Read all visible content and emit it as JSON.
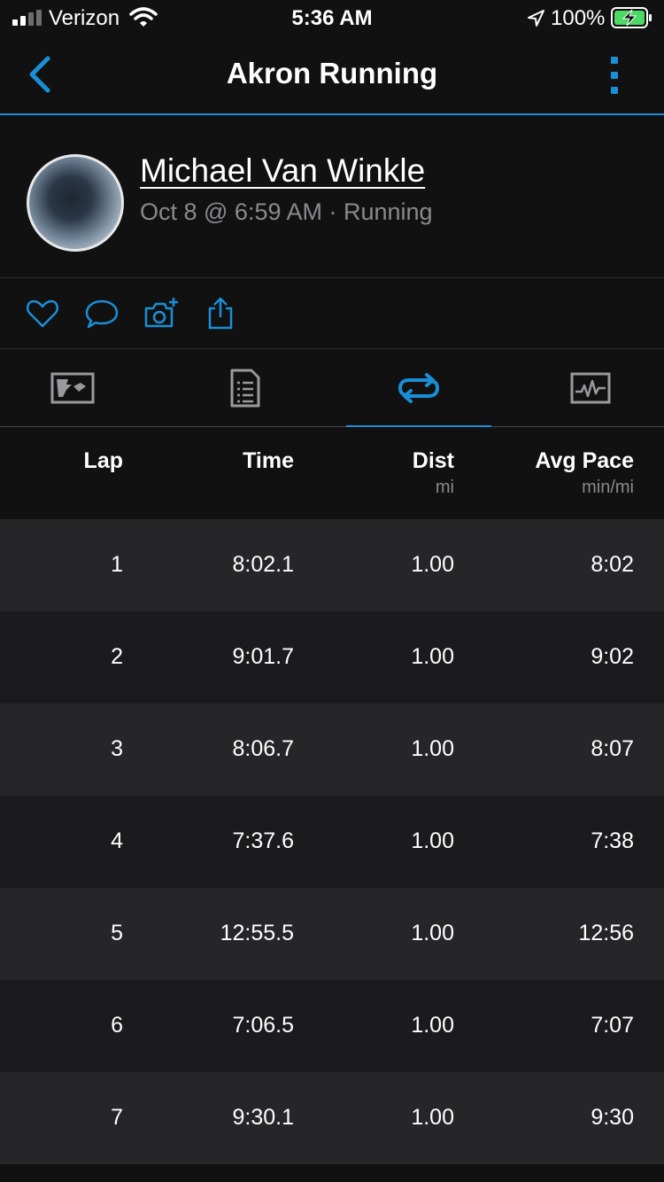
{
  "status_bar": {
    "carrier": "Verizon",
    "time": "5:36 AM",
    "battery": "100%"
  },
  "nav": {
    "title": "Akron Running",
    "back_icon": "chevron-left-icon",
    "more_icon": "more-vertical-icon"
  },
  "activity": {
    "user_name": "Michael Van Winkle",
    "subtitle": "Oct 8 @ 6:59 AM · Running"
  },
  "actions": [
    "like-icon",
    "comment-icon",
    "add-photo-icon",
    "share-icon"
  ],
  "tabs": [
    "map-tab",
    "details-tab",
    "laps-tab",
    "charts-tab"
  ],
  "active_tab": "laps-tab",
  "colors": {
    "accent": "#1a8fd6",
    "background": "#111112",
    "row_light": "#262628",
    "row_dark": "#1b1b1d",
    "muted_text": "#8a8a8e"
  },
  "table": {
    "headers": {
      "lap": "Lap",
      "time": "Time",
      "dist": "Dist",
      "dist_unit": "mi",
      "pace": "Avg Pace",
      "pace_unit": "min/mi"
    },
    "rows": [
      {
        "lap": "1",
        "time": "8:02.1",
        "dist": "1.00",
        "pace": "8:02"
      },
      {
        "lap": "2",
        "time": "9:01.7",
        "dist": "1.00",
        "pace": "9:02"
      },
      {
        "lap": "3",
        "time": "8:06.7",
        "dist": "1.00",
        "pace": "8:07"
      },
      {
        "lap": "4",
        "time": "7:37.6",
        "dist": "1.00",
        "pace": "7:38"
      },
      {
        "lap": "5",
        "time": "12:55.5",
        "dist": "1.00",
        "pace": "12:56"
      },
      {
        "lap": "6",
        "time": "7:06.5",
        "dist": "1.00",
        "pace": "7:07"
      },
      {
        "lap": "7",
        "time": "9:30.1",
        "dist": "1.00",
        "pace": "9:30"
      }
    ]
  }
}
